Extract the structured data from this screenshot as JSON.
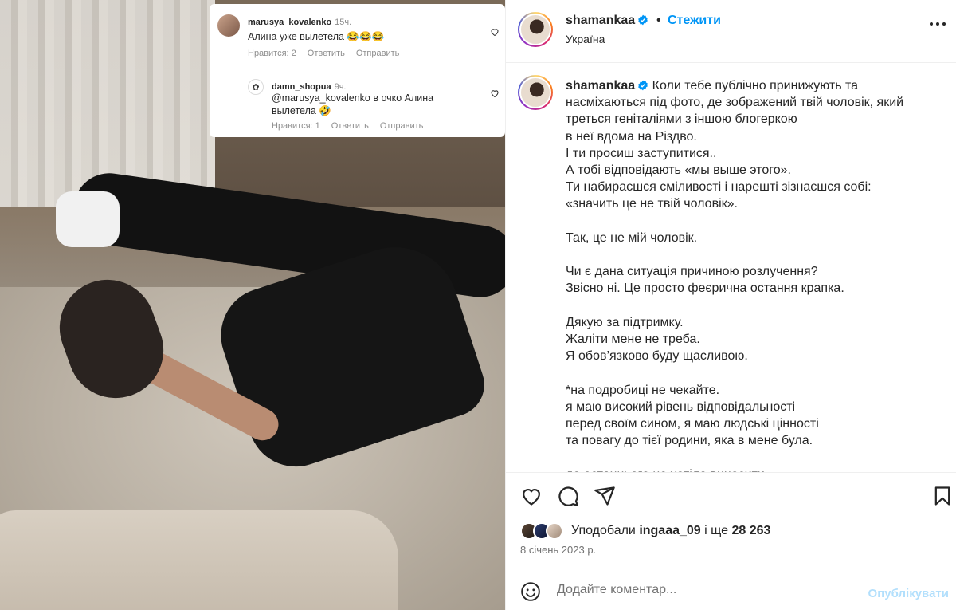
{
  "overlay": {
    "comment1": {
      "user": "marusya_kovalenko",
      "time": "15ч.",
      "text": "Алина уже вылетела 😂😂😂",
      "likes": "Нравится: 2",
      "reply": "Ответить",
      "send": "Отправить"
    },
    "comment2": {
      "user": "damn_shopua",
      "time": "9ч.",
      "text": "@marusya_kovalenko в очко Алина вылетела 🤣",
      "likes": "Нравится: 1",
      "reply": "Ответить",
      "send": "Отправить"
    }
  },
  "header": {
    "username": "shamankaa",
    "separator": "•",
    "follow_label": "Стежити",
    "location": "Україна"
  },
  "caption": {
    "username": "shamankaa",
    "text": "Коли тебе публічно принижують та насміхаються під фото, де зображений твій чоловік, який треться геніталіями з іншою блогеркою\nв неї вдома на Різдво.\nІ ти просиш заступитися..\nА тобі відповідають «мы выше этого».\nТи набираєшся сміливості і нарешті зізнаєшся собі:\n«значить це не твій чоловік».\n\nТак, це не мій чоловік.\n\nЧи є дана ситуація причиною розлучення?\nЗвісно ні. Це просто феєрична остання крапка.\n\nДякую за підтримку.\nЖаліти мене не треба.\nЯ обов’язково буду щасливою.\n\n*на подробиці не чекайте.\nя маю високий рівень відповідальності\nперед своїм сином, я маю людські цінності\nта повагу до тієї родини, яка в мене була.\n\nдо останнього не хотіла виносити"
  },
  "likes": {
    "prefix": "Уподобали",
    "user": "ingaaa_09",
    "middle": "і ще",
    "count": "28 263"
  },
  "date": "8 січень 2023 р.",
  "comment_box": {
    "placeholder": "Додайте коментар...",
    "publish_label": "Опублікувати"
  },
  "icons": {
    "like": "heart-icon",
    "comment": "comment-icon",
    "share": "share-icon",
    "save": "bookmark-icon",
    "more": "more-icon",
    "emoji": "emoji-icon",
    "verified": "verified-icon"
  },
  "colors": {
    "accent": "#0095f6",
    "publish_disabled": "#b2dffc",
    "text": "#262626",
    "muted": "#737373"
  }
}
